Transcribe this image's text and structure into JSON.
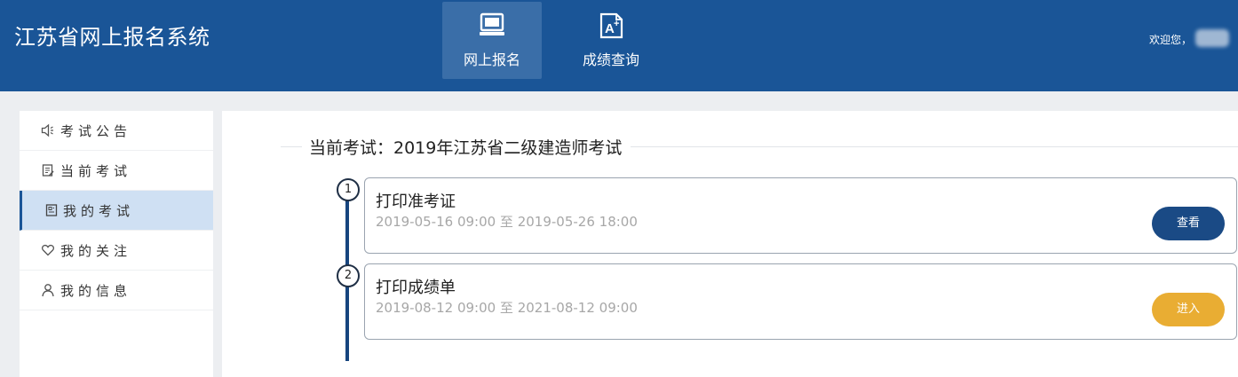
{
  "header": {
    "title": "江苏省网上报名系统",
    "nav": [
      {
        "label": "网上报名",
        "icon": "monitor-icon",
        "active": true
      },
      {
        "label": "成绩查询",
        "icon": "grade-document-icon",
        "active": false
      }
    ],
    "welcome": "欢迎您，"
  },
  "sidebar": {
    "items": [
      {
        "label": "考试公告",
        "icon": "speaker-icon"
      },
      {
        "label": "当前考试",
        "icon": "edit-document-icon"
      },
      {
        "label": "我的考试",
        "icon": "exam-document-icon",
        "active": true
      },
      {
        "label": "我的关注",
        "icon": "heart-icon"
      },
      {
        "label": "我的信息",
        "icon": "user-icon"
      }
    ]
  },
  "main": {
    "section_title": "当前考试：2019年江苏省二级建造师考试",
    "steps": [
      {
        "number": "1",
        "title": "打印准考证",
        "time": "2019-05-16 09:00 至 2019-05-26 18:00",
        "button": "查看",
        "button_color": "#1a4a85"
      },
      {
        "number": "2",
        "title": "打印成绩单",
        "time": "2019-08-12 09:00 至 2021-08-12 09:00",
        "button": "进入",
        "button_color": "#e9ad33"
      }
    ]
  },
  "colors": {
    "header_bg": "#1a5597",
    "nav_active_bg": "#3a6ea8",
    "sidebar_active_bg": "#cfe0f3",
    "timeline": "#17457e"
  }
}
